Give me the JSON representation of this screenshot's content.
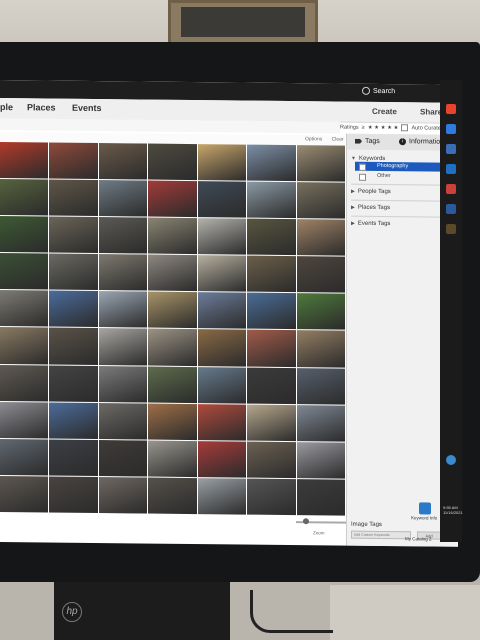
{
  "app": {
    "search_label": "Search",
    "nav": [
      "ple",
      "Places",
      "Events"
    ],
    "create_label": "Create",
    "share_label": "Share",
    "ratings_label": "Ratings",
    "ratings_op": "≥",
    "stars": "★ ★ ★ ★ ★",
    "auto_curate_label": "Auto Curate",
    "options_label": "Options",
    "clear_label": "Clear",
    "zoom_label": "Zoom"
  },
  "panel": {
    "tabs": [
      "Tags",
      "Information"
    ],
    "keywords_label": "Keywords",
    "keyword_items": [
      "Photography",
      "Other"
    ],
    "sections": [
      "People Tags",
      "Places Tags",
      "Events Tags"
    ],
    "image_tags_label": "Image Tags",
    "image_tags_placeholder": "Add Custom Keywords",
    "add_label": "Add",
    "keyword_info_label": "Keyword Info",
    "catalog_label": "My Catalog 2"
  },
  "taskbar": {
    "time": "9:55 AM",
    "date": "11/16/2021"
  },
  "photos": [
    "#b23a2a",
    "#8f4a3a",
    "#6b5a4a",
    "#4d4a3f",
    "#c9a66b",
    "#7c8fa6",
    "#9a8c72",
    "#56633e",
    "#5f5648",
    "#6f7c86",
    "#a23b39",
    "#3f4a56",
    "#8b9aa6",
    "#77705e",
    "#3d5a33",
    "#6b6558",
    "#5b5a55",
    "#8a8573",
    "#b4b3ad",
    "#58553f",
    "#a08367",
    "#3a4f35",
    "#6b6a63",
    "#7f7a70",
    "#8e8880",
    "#b6b0a0",
    "#6b5f49",
    "#4e463d",
    "#7d7b74",
    "#4b6c9c",
    "#9ba7b4",
    "#a99468",
    "#6c7d9a",
    "#4a6d97",
    "#4e7a3b",
    "#8a7a62",
    "#5a5248",
    "#a8a6a2",
    "#9c9384",
    "#8a6a45",
    "#a25b4a",
    "#947e64",
    "#5f5a52",
    "#444",
    "#7b7b7c",
    "#5d6c4c",
    "#667a8d",
    "#3b3b3b",
    "#56606c",
    "#8d8d93",
    "#4c6c9b",
    "#6d6a66",
    "#9e6f48",
    "#b04a3c",
    "#b7a88d",
    "#7f8894",
    "#606871",
    "#3c3f45",
    "#3f3b38",
    "#99968e",
    "#a83b3a",
    "#6d6153",
    "#9a9aa0",
    "#5d5750",
    "#4a4440",
    "#6f6862",
    "#55504a",
    "#9aa0a6",
    "#555",
    "#3c3c3c",
    "#8b8b85",
    "#2a2a2a",
    "#656565",
    "#b6b6b6",
    "#d8d6d2",
    "#e3e1dd",
    "#e8e6e2"
  ]
}
